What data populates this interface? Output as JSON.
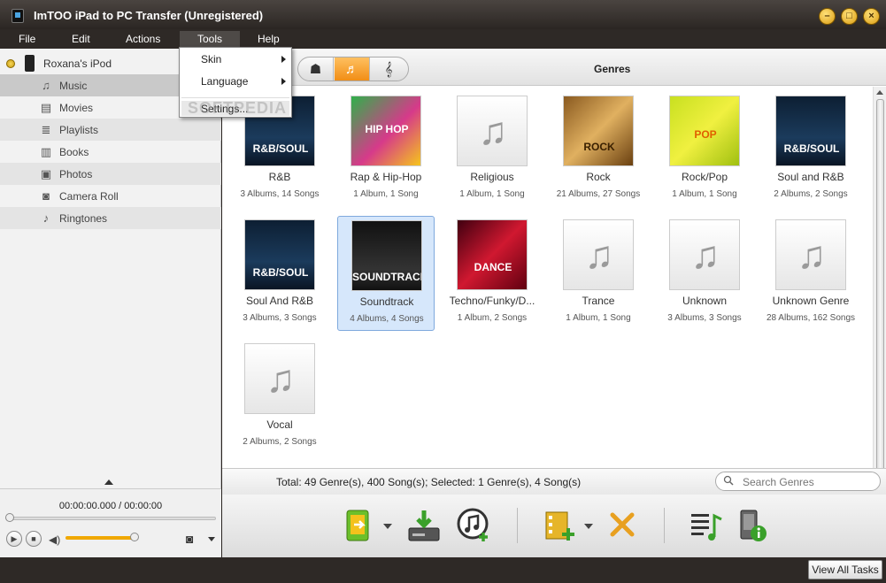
{
  "window": {
    "title": "ImTOO iPad to PC Transfer (Unregistered)",
    "buttons": [
      "–",
      "□",
      "×"
    ]
  },
  "menubar": {
    "items": [
      "File",
      "Edit",
      "Actions",
      "Tools",
      "Help"
    ]
  },
  "tools_menu": {
    "items": [
      "Skin",
      "Language",
      "Settings..."
    ]
  },
  "sidebar": {
    "device": "Roxana's iPod",
    "items": [
      {
        "label": "Music",
        "icon": "music-note-icon"
      },
      {
        "label": "Movies",
        "icon": "film-icon"
      },
      {
        "label": "Playlists",
        "icon": "playlist-icon"
      },
      {
        "label": "Books",
        "icon": "book-icon"
      },
      {
        "label": "Photos",
        "icon": "photo-icon"
      },
      {
        "label": "Camera Roll",
        "icon": "camera-icon"
      },
      {
        "label": "Ringtones",
        "icon": "ringtone-icon"
      }
    ]
  },
  "player": {
    "time": "00:00:00.000 / 00:00:00"
  },
  "view": {
    "title": "Genres"
  },
  "genres": [
    {
      "name": "R&B",
      "count": "3 Albums, 14 Songs",
      "art": "rb"
    },
    {
      "name": "Rap & Hip-Hop",
      "count": "1 Album, 1 Song",
      "art": "hiphop"
    },
    {
      "name": "Religious",
      "count": "1 Album, 1 Song",
      "art": "placeholder"
    },
    {
      "name": "Rock",
      "count": "21 Albums, 27 Songs",
      "art": "rock"
    },
    {
      "name": "Rock/Pop",
      "count": "1 Album, 1 Song",
      "art": "pop"
    },
    {
      "name": "Soul and R&B",
      "count": "2 Albums, 2 Songs",
      "art": "rb"
    },
    {
      "name": "Soul And R&B",
      "count": "3 Albums, 3 Songs",
      "art": "rb"
    },
    {
      "name": "Soundtrack",
      "count": "4 Albums, 4 Songs",
      "art": "soundtrack"
    },
    {
      "name": "Techno/Funky/D...",
      "count": "1 Album, 2 Songs",
      "art": "dance"
    },
    {
      "name": "Trance",
      "count": "1 Album, 1 Song",
      "art": "placeholder"
    },
    {
      "name": "Unknown",
      "count": "3 Albums, 3 Songs",
      "art": "placeholder"
    },
    {
      "name": "Unknown Genre",
      "count": "28 Albums, 162 Songs",
      "art": "placeholder"
    },
    {
      "name": "Vocal",
      "count": "2 Albums, 2 Songs",
      "art": "placeholder"
    }
  ],
  "art_labels": {
    "rb": "R&B/SOUL",
    "hiphop": "HIP HOP",
    "rock": "ROCK",
    "pop": "POP",
    "soundtrack": "SOUNDTRACK",
    "dance": "DANCE"
  },
  "status": {
    "text": "Total: 49 Genre(s), 400 Song(s); Selected: 1 Genre(s), 4 Song(s)",
    "search_placeholder": "Search Genres"
  },
  "footer": {
    "view_all": "View All Tasks"
  },
  "watermark": "SOFTPEDIA",
  "colors": {
    "accent": "#f08a10",
    "selection": "#d6e7fb"
  }
}
